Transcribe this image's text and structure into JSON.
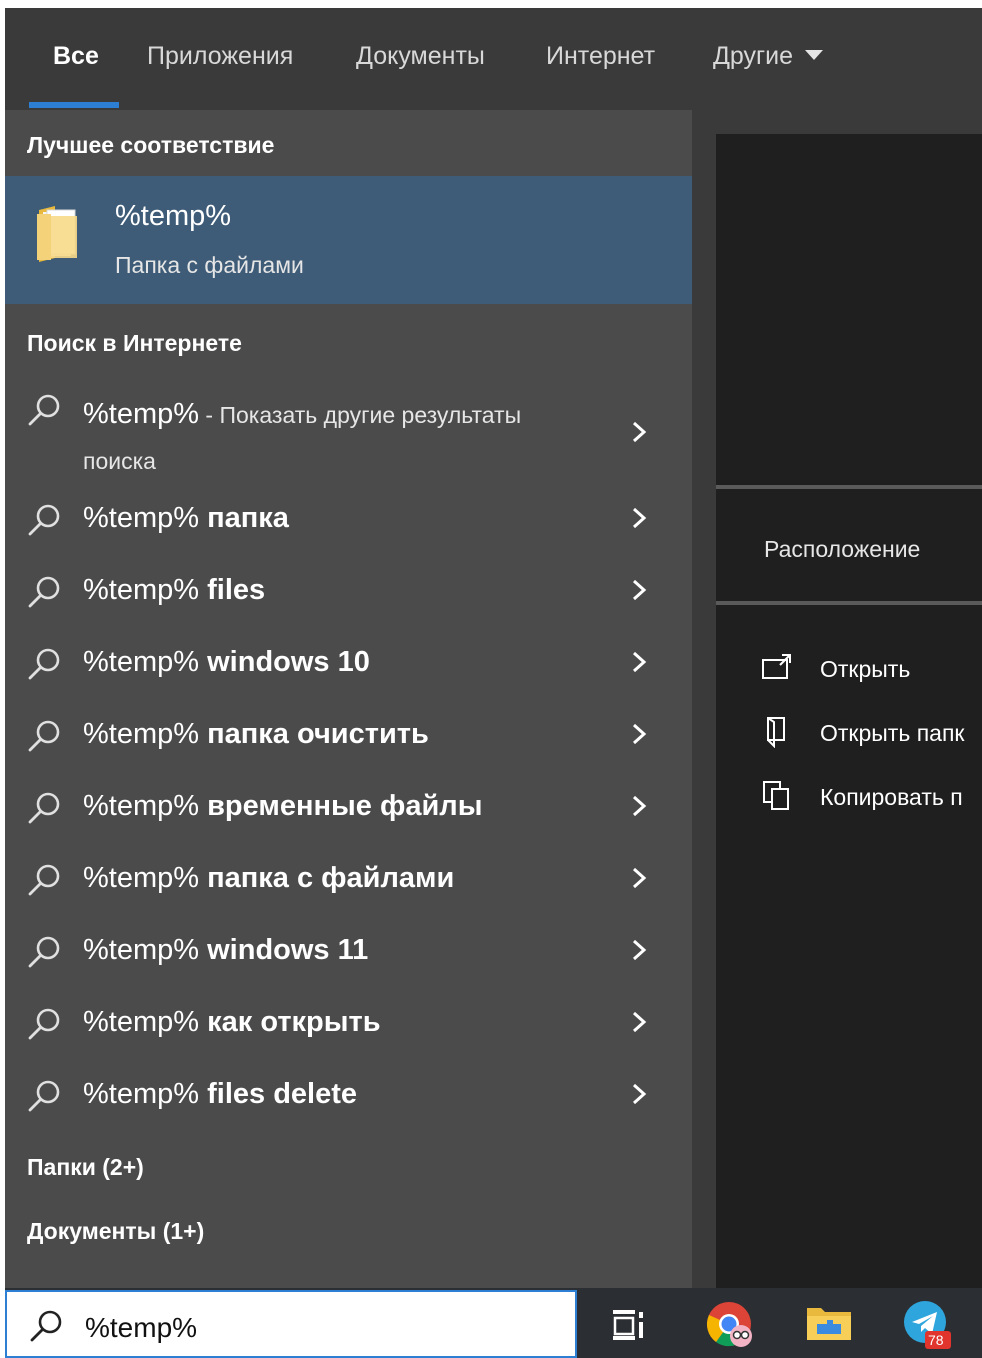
{
  "tabs": [
    {
      "label": "Все",
      "active": true
    },
    {
      "label": "Приложения"
    },
    {
      "label": "Документы"
    },
    {
      "label": "Интернет"
    },
    {
      "label": "Другие"
    }
  ],
  "best_match": {
    "title": "Лучшее соответствие",
    "name": "%temp%",
    "subtitle": "Папка с файлами",
    "icon": "folder-icon"
  },
  "web_search": {
    "title": "Поиск в Интернете",
    "first": {
      "query": "%temp%",
      "suffix": " - Показать другие результаты",
      "line2": "поиска"
    },
    "items": [
      {
        "prefix": "%temp%",
        "term": "папка"
      },
      {
        "prefix": "%temp%",
        "term": "files"
      },
      {
        "prefix": "%temp%",
        "term": "windows 10"
      },
      {
        "prefix": "%temp%",
        "term": "папка очистить"
      },
      {
        "prefix": "%temp%",
        "term": "временные файлы"
      },
      {
        "prefix": "%temp%",
        "term": "папка с файлами"
      },
      {
        "prefix": "%temp%",
        "term": "windows 11"
      },
      {
        "prefix": "%temp%",
        "term": "как открыть"
      },
      {
        "prefix": "%temp%",
        "term": "files delete"
      }
    ]
  },
  "folders_section": "Папки (2+)",
  "documents_section": "Документы (1+)",
  "details": {
    "location_label": "Расположение",
    "actions": [
      {
        "label": "Открыть",
        "icon": "open-icon"
      },
      {
        "label": "Открыть папк",
        "icon": "open-folder-icon"
      },
      {
        "label": "Копировать п",
        "icon": "copy-icon"
      }
    ]
  },
  "search": {
    "value": "%temp%"
  },
  "taskbar": {
    "items": [
      "task-view-icon",
      "chrome-icon",
      "file-explorer-icon",
      "telegram-icon"
    ],
    "telegram_badge": "78"
  },
  "colors": {
    "accent": "#2d7fd3",
    "selected_bg": "#3e5c78",
    "results_bg": "#4b4b4b",
    "panel_bg": "#1f1f1f"
  }
}
